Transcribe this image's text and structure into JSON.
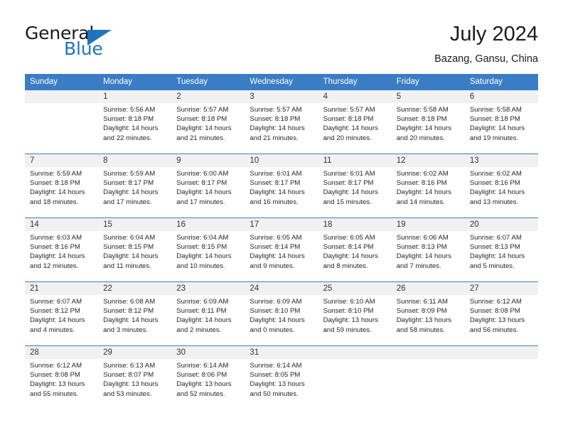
{
  "brand": {
    "word_general": "General",
    "word_blue": "Blue",
    "flag_icon": "triangle-flag-icon"
  },
  "header": {
    "month_title": "July 2024",
    "location": "Bazang, Gansu, China"
  },
  "colors": {
    "header_blue": "#3b7dc4",
    "brand_blue": "#1f74bd",
    "daynum_bg": "#f1f1f1",
    "text": "#262626"
  },
  "calendar": {
    "weekdays": [
      "Sunday",
      "Monday",
      "Tuesday",
      "Wednesday",
      "Thursday",
      "Friday",
      "Saturday"
    ],
    "weeks": [
      [
        {
          "day": "",
          "sunrise": "",
          "sunset": "",
          "daylight1": "",
          "daylight2": ""
        },
        {
          "day": "1",
          "sunrise": "Sunrise: 5:56 AM",
          "sunset": "Sunset: 8:18 PM",
          "daylight1": "Daylight: 14 hours",
          "daylight2": "and 22 minutes."
        },
        {
          "day": "2",
          "sunrise": "Sunrise: 5:57 AM",
          "sunset": "Sunset: 8:18 PM",
          "daylight1": "Daylight: 14 hours",
          "daylight2": "and 21 minutes."
        },
        {
          "day": "3",
          "sunrise": "Sunrise: 5:57 AM",
          "sunset": "Sunset: 8:18 PM",
          "daylight1": "Daylight: 14 hours",
          "daylight2": "and 21 minutes."
        },
        {
          "day": "4",
          "sunrise": "Sunrise: 5:57 AM",
          "sunset": "Sunset: 8:18 PM",
          "daylight1": "Daylight: 14 hours",
          "daylight2": "and 20 minutes."
        },
        {
          "day": "5",
          "sunrise": "Sunrise: 5:58 AM",
          "sunset": "Sunset: 8:18 PM",
          "daylight1": "Daylight: 14 hours",
          "daylight2": "and 20 minutes."
        },
        {
          "day": "6",
          "sunrise": "Sunrise: 5:58 AM",
          "sunset": "Sunset: 8:18 PM",
          "daylight1": "Daylight: 14 hours",
          "daylight2": "and 19 minutes."
        }
      ],
      [
        {
          "day": "7",
          "sunrise": "Sunrise: 5:59 AM",
          "sunset": "Sunset: 8:18 PM",
          "daylight1": "Daylight: 14 hours",
          "daylight2": "and 18 minutes."
        },
        {
          "day": "8",
          "sunrise": "Sunrise: 5:59 AM",
          "sunset": "Sunset: 8:17 PM",
          "daylight1": "Daylight: 14 hours",
          "daylight2": "and 17 minutes."
        },
        {
          "day": "9",
          "sunrise": "Sunrise: 6:00 AM",
          "sunset": "Sunset: 8:17 PM",
          "daylight1": "Daylight: 14 hours",
          "daylight2": "and 17 minutes."
        },
        {
          "day": "10",
          "sunrise": "Sunrise: 6:01 AM",
          "sunset": "Sunset: 8:17 PM",
          "daylight1": "Daylight: 14 hours",
          "daylight2": "and 16 minutes."
        },
        {
          "day": "11",
          "sunrise": "Sunrise: 6:01 AM",
          "sunset": "Sunset: 8:17 PM",
          "daylight1": "Daylight: 14 hours",
          "daylight2": "and 15 minutes."
        },
        {
          "day": "12",
          "sunrise": "Sunrise: 6:02 AM",
          "sunset": "Sunset: 8:16 PM",
          "daylight1": "Daylight: 14 hours",
          "daylight2": "and 14 minutes."
        },
        {
          "day": "13",
          "sunrise": "Sunrise: 6:02 AM",
          "sunset": "Sunset: 8:16 PM",
          "daylight1": "Daylight: 14 hours",
          "daylight2": "and 13 minutes."
        }
      ],
      [
        {
          "day": "14",
          "sunrise": "Sunrise: 6:03 AM",
          "sunset": "Sunset: 8:16 PM",
          "daylight1": "Daylight: 14 hours",
          "daylight2": "and 12 minutes."
        },
        {
          "day": "15",
          "sunrise": "Sunrise: 6:04 AM",
          "sunset": "Sunset: 8:15 PM",
          "daylight1": "Daylight: 14 hours",
          "daylight2": "and 11 minutes."
        },
        {
          "day": "16",
          "sunrise": "Sunrise: 6:04 AM",
          "sunset": "Sunset: 8:15 PM",
          "daylight1": "Daylight: 14 hours",
          "daylight2": "and 10 minutes."
        },
        {
          "day": "17",
          "sunrise": "Sunrise: 6:05 AM",
          "sunset": "Sunset: 8:14 PM",
          "daylight1": "Daylight: 14 hours",
          "daylight2": "and 9 minutes."
        },
        {
          "day": "18",
          "sunrise": "Sunrise: 6:05 AM",
          "sunset": "Sunset: 8:14 PM",
          "daylight1": "Daylight: 14 hours",
          "daylight2": "and 8 minutes."
        },
        {
          "day": "19",
          "sunrise": "Sunrise: 6:06 AM",
          "sunset": "Sunset: 8:13 PM",
          "daylight1": "Daylight: 14 hours",
          "daylight2": "and 7 minutes."
        },
        {
          "day": "20",
          "sunrise": "Sunrise: 6:07 AM",
          "sunset": "Sunset: 8:13 PM",
          "daylight1": "Daylight: 14 hours",
          "daylight2": "and 5 minutes."
        }
      ],
      [
        {
          "day": "21",
          "sunrise": "Sunrise: 6:07 AM",
          "sunset": "Sunset: 8:12 PM",
          "daylight1": "Daylight: 14 hours",
          "daylight2": "and 4 minutes."
        },
        {
          "day": "22",
          "sunrise": "Sunrise: 6:08 AM",
          "sunset": "Sunset: 8:12 PM",
          "daylight1": "Daylight: 14 hours",
          "daylight2": "and 3 minutes."
        },
        {
          "day": "23",
          "sunrise": "Sunrise: 6:09 AM",
          "sunset": "Sunset: 8:11 PM",
          "daylight1": "Daylight: 14 hours",
          "daylight2": "and 2 minutes."
        },
        {
          "day": "24",
          "sunrise": "Sunrise: 6:09 AM",
          "sunset": "Sunset: 8:10 PM",
          "daylight1": "Daylight: 14 hours",
          "daylight2": "and 0 minutes."
        },
        {
          "day": "25",
          "sunrise": "Sunrise: 6:10 AM",
          "sunset": "Sunset: 8:10 PM",
          "daylight1": "Daylight: 13 hours",
          "daylight2": "and 59 minutes."
        },
        {
          "day": "26",
          "sunrise": "Sunrise: 6:11 AM",
          "sunset": "Sunset: 8:09 PM",
          "daylight1": "Daylight: 13 hours",
          "daylight2": "and 58 minutes."
        },
        {
          "day": "27",
          "sunrise": "Sunrise: 6:12 AM",
          "sunset": "Sunset: 8:08 PM",
          "daylight1": "Daylight: 13 hours",
          "daylight2": "and 56 minutes."
        }
      ],
      [
        {
          "day": "28",
          "sunrise": "Sunrise: 6:12 AM",
          "sunset": "Sunset: 8:08 PM",
          "daylight1": "Daylight: 13 hours",
          "daylight2": "and 55 minutes."
        },
        {
          "day": "29",
          "sunrise": "Sunrise: 6:13 AM",
          "sunset": "Sunset: 8:07 PM",
          "daylight1": "Daylight: 13 hours",
          "daylight2": "and 53 minutes."
        },
        {
          "day": "30",
          "sunrise": "Sunrise: 6:14 AM",
          "sunset": "Sunset: 8:06 PM",
          "daylight1": "Daylight: 13 hours",
          "daylight2": "and 52 minutes."
        },
        {
          "day": "31",
          "sunrise": "Sunrise: 6:14 AM",
          "sunset": "Sunset: 8:05 PM",
          "daylight1": "Daylight: 13 hours",
          "daylight2": "and 50 minutes."
        },
        {
          "day": "",
          "sunrise": "",
          "sunset": "",
          "daylight1": "",
          "daylight2": ""
        },
        {
          "day": "",
          "sunrise": "",
          "sunset": "",
          "daylight1": "",
          "daylight2": ""
        },
        {
          "day": "",
          "sunrise": "",
          "sunset": "",
          "daylight1": "",
          "daylight2": ""
        }
      ]
    ]
  }
}
